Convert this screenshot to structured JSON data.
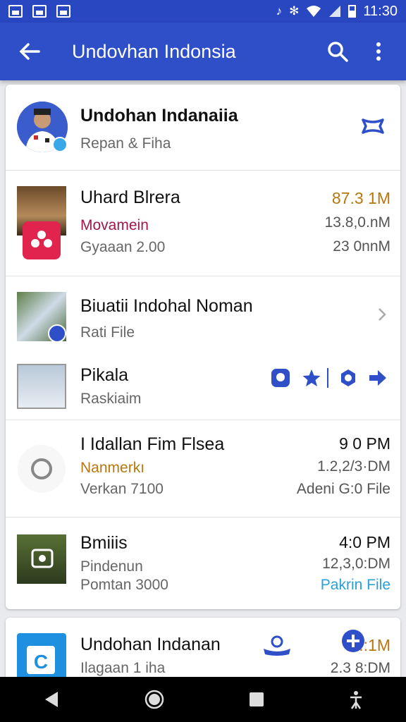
{
  "status_bar": {
    "time": "11:30",
    "indicators": [
      "image-icon",
      "gallery-icon",
      "calendar-icon",
      "vibrate-icon",
      "mute-icon",
      "wifi-icon",
      "signal-icon",
      "battery-icon"
    ]
  },
  "app_bar": {
    "title": "Undovhan Indonsia",
    "icons": [
      "back-arrow-icon",
      "search-icon",
      "more-vert-icon"
    ]
  },
  "rows": [
    {
      "name": "Undohan Indanaiia",
      "sub": "Repan & Fiha",
      "icon": "ribbon-icon"
    },
    {
      "name": "Uhard Blrera",
      "sub1": "Movamein",
      "sub2": "Gyaaan 2.00",
      "meta1": "87.3 1M",
      "meta2": "13.8,0.nM",
      "meta3": "23 0nnM",
      "badge_icon": "flower-app-icon"
    },
    {
      "name": "Biuatii Indohal Noman",
      "sub": "Rati File",
      "icon": "chevron-right-icon"
    },
    {
      "name": "Pikala",
      "sub": "Raskiaim",
      "actions": [
        "location-pin-icon",
        "star-icon",
        "settings-icon",
        "share-icon"
      ]
    },
    {
      "name": "I Idallan Fim Flsea",
      "sub1": "Nanmerkı",
      "sub2": "Verkan 7100",
      "meta1": "9 0 PM",
      "meta2": "1.2,2/3·DM",
      "meta3": "Adeni G:0 File",
      "icon": "radio-icon"
    },
    {
      "name": "Bmiiis",
      "sub1": "Pindenun",
      "sub2": "Pomtan 3000",
      "meta1": "4:0 PM",
      "meta2": "12,3,0:DM",
      "meta3": "Pakrin File",
      "icon": "camera-icon"
    }
  ],
  "bottom_card": {
    "name": "Undohan Indanan",
    "sub": "Ilagaan 1 iha",
    "meta1": "5.:1M",
    "meta2": "2.3 8:DM",
    "icons": [
      "hand-ribbon-icon",
      "add-circle-icon",
      "file-c-icon"
    ]
  },
  "nav_bar": {
    "icons": [
      "back-triangle-icon",
      "home-circle-icon",
      "recents-square-icon",
      "accessibility-icon"
    ]
  },
  "colors": {
    "primary": "#2f4fc9",
    "accent_blue": "#2f4fc9",
    "orange": "#b87710",
    "link": "#2aa0d6",
    "red_text": "#a0174a"
  }
}
